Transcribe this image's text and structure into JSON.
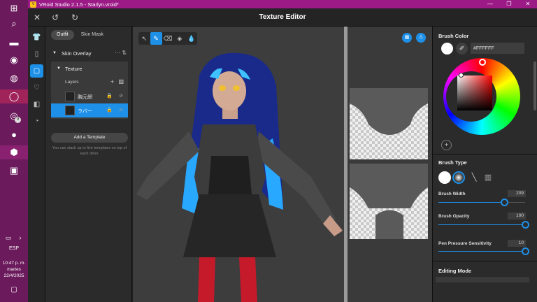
{
  "window": {
    "title": "VRoid Studio 2.1.5 - Starlyn.vroid*",
    "controls": [
      "—",
      "❐",
      "✕"
    ]
  },
  "header": {
    "title": "Texture Editor",
    "close_glyph": "✕",
    "undo_glyph": "↺",
    "redo_glyph": "↻"
  },
  "taskbar": {
    "icons": [
      "windows-icon",
      "search-icon",
      "file-explorer-icon",
      "firefox-icon",
      "discord-icon",
      "opera-icon",
      "whatsapp-icon",
      "steam-icon",
      "vroid-icon",
      "gallery-icon"
    ],
    "whatsapp_badge": "9",
    "language": "ESP",
    "time": "10:47 p. m.",
    "day": "martes",
    "date": "22/4/2025"
  },
  "left_panel": {
    "tabs": [
      {
        "label": "Outfit",
        "active": true
      },
      {
        "label": "Skin Mask",
        "active": false
      }
    ],
    "section": {
      "label": "Skin Overlay"
    },
    "texture": {
      "label": "Texture",
      "layers_label": "Layers",
      "layers": [
        {
          "name": "胸元網",
          "selected": false
        },
        {
          "name": "ラバー",
          "selected": true
        }
      ]
    },
    "add_template_label": "Add a Template",
    "template_note": "You can stack up to five templates on top of each other."
  },
  "viewport": {
    "tools": [
      "pointer-icon",
      "pen-icon",
      "eraser-icon",
      "fill-icon",
      "blur-icon"
    ],
    "active_tool": "pen-icon"
  },
  "properties": {
    "brush_color": {
      "title": "Brush Color",
      "hex": "#FFFFFF",
      "swatch_color": "#ffffff",
      "hue_color": "#ff0000"
    },
    "brush_type": {
      "title": "Brush Type",
      "options": [
        "round-brush-icon",
        "soft-brush-icon",
        "line-brush-icon",
        "texture-brush-icon"
      ],
      "selected": "soft-brush-icon"
    },
    "brush_width": {
      "label": "Brush Width",
      "value": "209",
      "fraction": 0.76
    },
    "brush_opacity": {
      "label": "Brush Opacity",
      "value": "100",
      "fraction": 1.0
    },
    "pen_pressure": {
      "label": "Pen Pressure Sensitivity",
      "value": "10",
      "fraction": 1.0
    },
    "editing_mode": {
      "title": "Editing Mode"
    }
  },
  "colors": {
    "accent": "#1e90e8",
    "titlebar": "#9b1a86",
    "taskbar": "#6b1a5c"
  }
}
